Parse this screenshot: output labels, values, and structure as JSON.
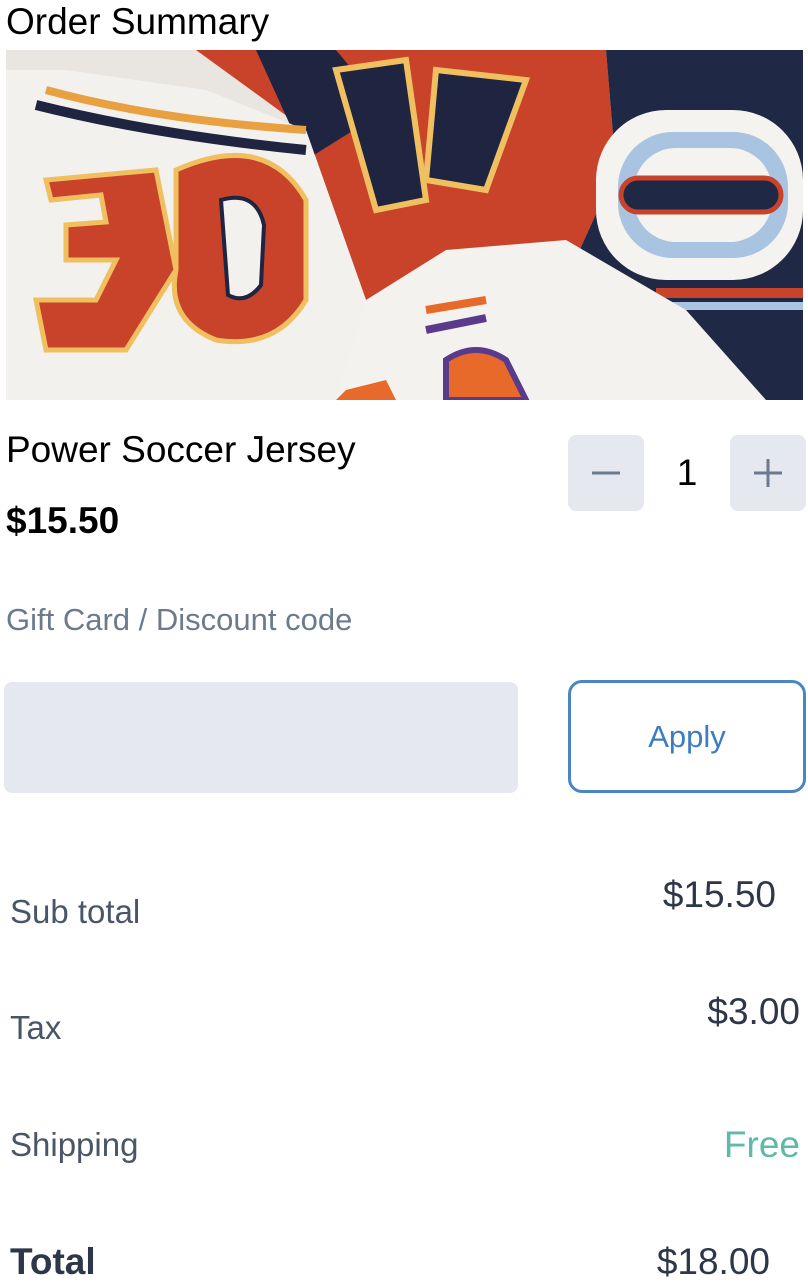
{
  "page": {
    "title": "Order Summary"
  },
  "product": {
    "name": "Power Soccer Jersey",
    "price": "$15.50",
    "image_icon": "jersey-photo"
  },
  "quantity": {
    "value": "1",
    "minus_icon": "minus-icon",
    "plus_icon": "plus-icon"
  },
  "discount": {
    "label": "Gift Card / Discount code",
    "input_value": "",
    "placeholder": "",
    "apply_label": "Apply"
  },
  "summary": {
    "subtotal_label": "Sub total",
    "subtotal_value": "$15.50",
    "tax_label": "Tax",
    "tax_value": "$3.00",
    "shipping_label": "Shipping",
    "shipping_value": "Free",
    "total_label": "Total",
    "total_value": "$18.00"
  },
  "colors": {
    "accent": "#4a86c5",
    "free_text": "#5fb8a8",
    "label_gray": "#6b7a8d",
    "button_bg": "#e5e8ee"
  }
}
